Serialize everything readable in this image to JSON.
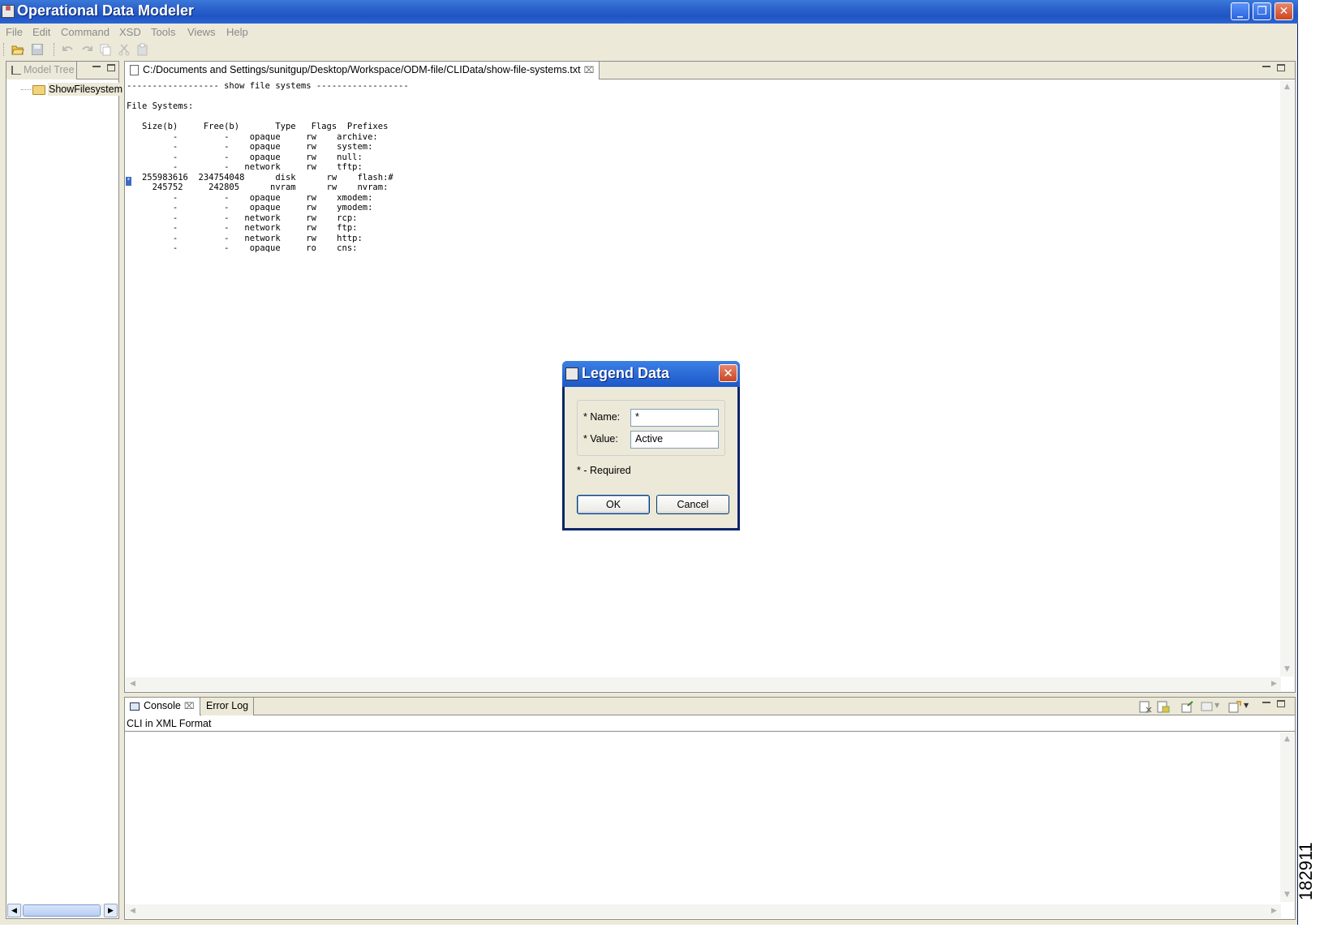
{
  "window": {
    "title": "Operational Data Modeler",
    "accent": "#2a5fcc",
    "controls": [
      "minimize-icon",
      "restore-icon",
      "close-icon"
    ]
  },
  "menu": {
    "items": [
      "File",
      "Edit",
      "Command",
      "XSD",
      "Tools",
      "Views",
      "Help"
    ]
  },
  "toolbar": {
    "icons": [
      "open-folder-icon",
      "save-icon",
      "undo-icon",
      "redo-icon",
      "copy-icon",
      "cut-icon",
      "paste-icon"
    ]
  },
  "model_tree": {
    "tab_label": "Model Tree",
    "items": [
      {
        "label": "ShowFilesystem",
        "icon": "folder-icon"
      }
    ]
  },
  "editor": {
    "tab_label": "C:/Documents and Settings/sunitgup/Desktop/Workspace/ODM-file/CLIData/show-file-systems.txt",
    "header_line": "------------------ show file systems ------------------",
    "section_title": "File Systems:",
    "columns_line": "   Size(b)     Free(b)       Type   Flags  Prefixes",
    "rows": [
      "         -         -    opaque     rw    archive:",
      "         -         -    opaque     rw    system:",
      "         -         -    opaque     rw    null:",
      "         -         -   network     rw    tftp:",
      "   255983616  234754048      disk      rw    flash:#",
      "     245752     242805      nvram      rw    nvram:",
      "         -         -    opaque     rw    xmodem:",
      "         -         -    opaque     rw    ymodem:",
      "         -         -   network     rw    rcp:",
      "         -         -   network     rw    ftp:",
      "         -         -   network     rw    http:",
      "         -         -    opaque     ro    cns:"
    ],
    "marker_symbol": "*"
  },
  "console": {
    "tabs": [
      "Console",
      "Error Log"
    ],
    "subtitle": "CLI in XML Format"
  },
  "dialog": {
    "title": "Legend Data",
    "name_label": "* Name:",
    "name_value": "*",
    "value_label": "* Value:",
    "value_value": "Active",
    "required_note": "* - Required",
    "ok_label": "OK",
    "cancel_label": "Cancel"
  },
  "figure_number": "182911"
}
